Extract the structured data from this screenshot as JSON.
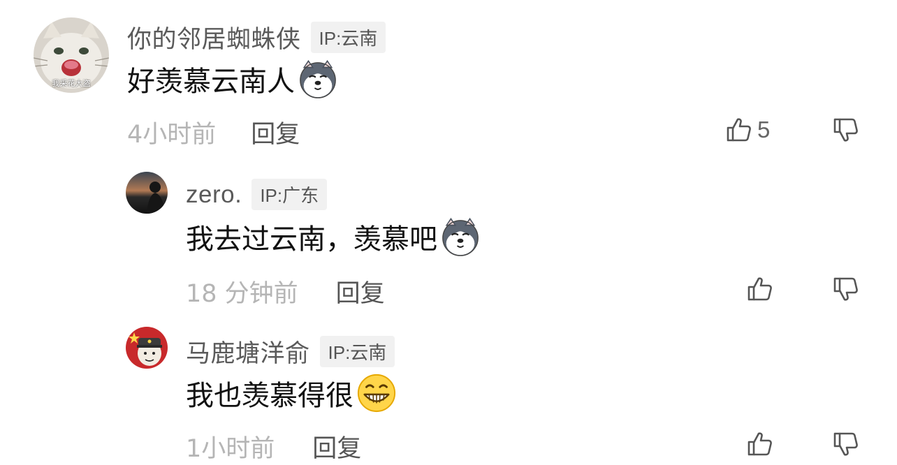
{
  "comments": [
    {
      "username": "你的邻居蜘蛛侠",
      "ip": "IP:云南",
      "content": "好羡慕云南人",
      "emoji": "husky-emoji",
      "time": "4小时前",
      "reply_label": "回复",
      "likes": "5",
      "avatar_caption": "我采花大盗"
    },
    {
      "username": "zero.",
      "ip": "IP:广东",
      "content": "我去过云南，羡慕吧",
      "emoji": "husky-emoji",
      "time": "18 分钟前",
      "reply_label": "回复",
      "likes": ""
    },
    {
      "username": "马鹿塘洋俞",
      "ip": "IP:云南",
      "content": "我也羡慕得很",
      "emoji": "grin-emoji",
      "time": "1小时前",
      "reply_label": "回复",
      "likes": ""
    }
  ],
  "icons": {
    "like": "thumbs-up-icon",
    "dislike": "thumbs-down-icon"
  },
  "colors": {
    "username": "#5a5a5a",
    "timestamp": "#b5b5b5",
    "badge_bg": "#f1f1f1",
    "icon_stroke": "#555555"
  }
}
